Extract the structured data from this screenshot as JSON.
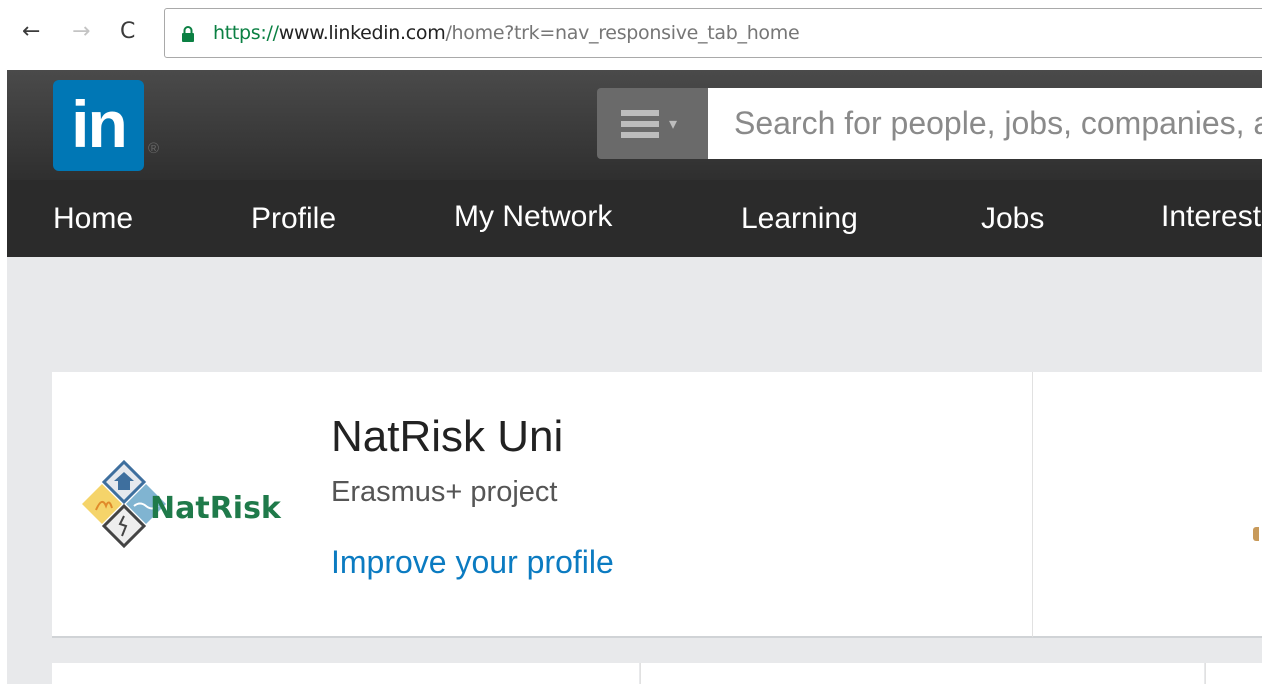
{
  "browser": {
    "back_icon": "←",
    "forward_icon": "→",
    "reload_icon": "C",
    "url_scheme": "https://",
    "url_host": "www.linkedin.com",
    "url_path": "/home?trk=nav_responsive_tab_home"
  },
  "header": {
    "logo_text": "in",
    "registered_mark": "®",
    "search_menu_caret": "▾",
    "search_placeholder": "Search for people, jobs, companies, and more..."
  },
  "nav": {
    "items": [
      {
        "label": "Home"
      },
      {
        "label": "Profile"
      },
      {
        "label": "My Network"
      },
      {
        "label": "Learning"
      },
      {
        "label": "Jobs"
      },
      {
        "label": "Interests"
      }
    ]
  },
  "profile": {
    "org_logo_text": "NatRisk",
    "name": "NatRisk Uni",
    "headline": "Erasmus+ project",
    "improve_link": "Improve your profile"
  },
  "colors": {
    "linkedin_blue": "#0077b5",
    "link_blue": "#0b7bc1",
    "header_dark": "#3a3a3a",
    "nav_dark": "#2b2b2b",
    "page_bg": "#e8e9eb",
    "logo_green": "#1f7a4a",
    "secure_green": "#0b8043"
  }
}
